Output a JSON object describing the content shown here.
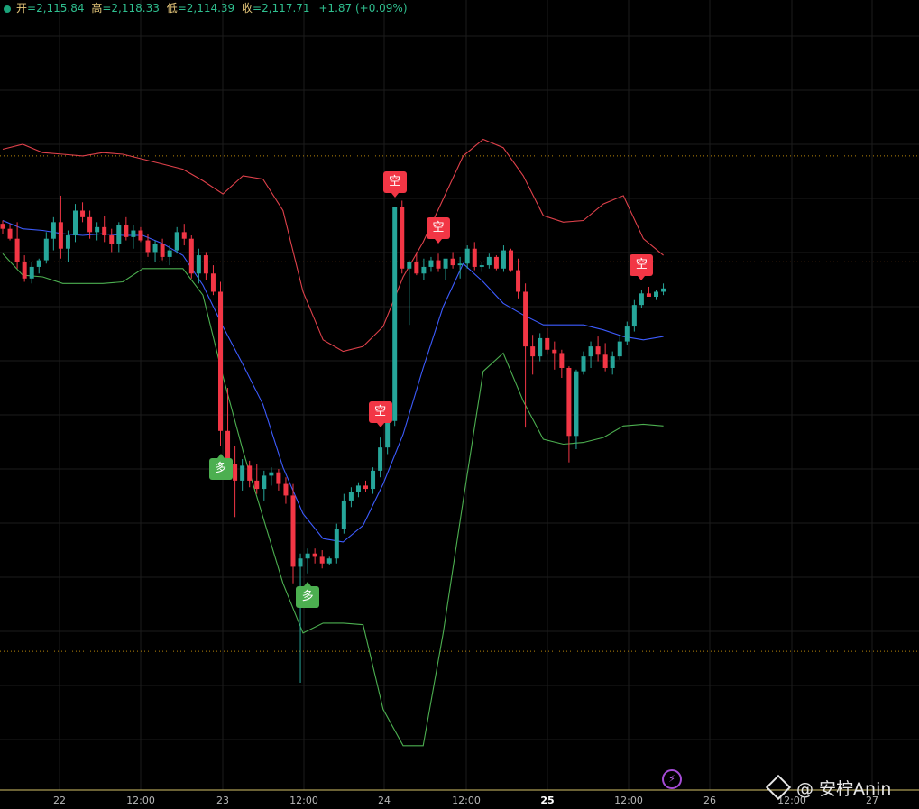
{
  "header": {
    "open_label": "开",
    "open_value": "=2,115.84",
    "high_label": "高",
    "high_value": "=2,118.33",
    "low_label": "低",
    "low_value": "=2,114.39",
    "close_label": "收",
    "close_value": "=2,117.71",
    "change": "+1.87 (+0.09%)"
  },
  "x_axis": {
    "ticks": [
      {
        "label": "22",
        "bold": false
      },
      {
        "label": "12:00",
        "bold": false
      },
      {
        "label": "23",
        "bold": false
      },
      {
        "label": "12:00",
        "bold": false
      },
      {
        "label": "24",
        "bold": false
      },
      {
        "label": "12:00",
        "bold": false
      },
      {
        "label": "25",
        "bold": true
      },
      {
        "label": "12:00",
        "bold": false
      },
      {
        "label": "26",
        "bold": false
      },
      {
        "label": "12:00",
        "bold": false
      },
      {
        "label": "27",
        "bold": false
      }
    ]
  },
  "signals": {
    "short_label": "空",
    "long_label": "多"
  },
  "watermark": {
    "text": "@ 安柠Anin",
    "icon": "binance-square-icon"
  },
  "bolt_icon": "lightning-icon",
  "colors": {
    "up": "#26a69a",
    "down": "#f23645",
    "upper_band": "#e0414b",
    "middle_band": "#3d5cff",
    "lower_band": "#4caf50",
    "dotted_line": "#b8860b",
    "price_line": "#d2691e"
  },
  "chart_data": {
    "type": "candlestick",
    "indicator": "bollinger-bands",
    "price_range": [
      1860,
      2180
    ],
    "candles": [
      [
        2137,
        2139,
        2131,
        2134
      ],
      [
        2134,
        2137,
        2127,
        2128
      ],
      [
        2128,
        2138,
        2110,
        2114
      ],
      [
        2114,
        2118,
        2102,
        2104
      ],
      [
        2104,
        2114,
        2101,
        2111
      ],
      [
        2111,
        2116,
        2107,
        2115
      ],
      [
        2115,
        2132,
        2113,
        2128
      ],
      [
        2128,
        2141,
        2121,
        2138
      ],
      [
        2138,
        2154,
        2116,
        2122
      ],
      [
        2122,
        2133,
        2114,
        2130
      ],
      [
        2130,
        2149,
        2126,
        2145
      ],
      [
        2145,
        2150,
        2138,
        2141
      ],
      [
        2141,
        2145,
        2128,
        2132
      ],
      [
        2132,
        2138,
        2127,
        2135
      ],
      [
        2135,
        2142,
        2126,
        2130
      ],
      [
        2130,
        2134,
        2120,
        2125
      ],
      [
        2125,
        2138,
        2120,
        2136
      ],
      [
        2136,
        2141,
        2127,
        2129
      ],
      [
        2129,
        2136,
        2122,
        2133
      ],
      [
        2133,
        2135,
        2126,
        2127
      ],
      [
        2127,
        2131,
        2117,
        2120
      ],
      [
        2120,
        2127,
        2114,
        2125
      ],
      [
        2125,
        2128,
        2115,
        2117
      ],
      [
        2117,
        2124,
        2112,
        2121
      ],
      [
        2121,
        2135,
        2119,
        2132
      ],
      [
        2132,
        2137,
        2124,
        2128
      ],
      [
        2128,
        2130,
        2104,
        2107
      ],
      [
        2107,
        2122,
        2101,
        2118
      ],
      [
        2118,
        2120,
        2103,
        2107
      ],
      [
        2107,
        2112,
        2094,
        2096
      ],
      [
        2096,
        2102,
        2003,
        2012
      ],
      [
        2012,
        2038,
        1988,
        1992
      ],
      [
        1992,
        2003,
        1960,
        1982
      ],
      [
        1982,
        1995,
        1976,
        1991
      ],
      [
        1991,
        1994,
        1978,
        1982
      ],
      [
        1982,
        1992,
        1974,
        1977
      ],
      [
        1977,
        1988,
        1970,
        1985
      ],
      [
        1985,
        1990,
        1979,
        1987
      ],
      [
        1987,
        1989,
        1976,
        1980
      ],
      [
        1980,
        1984,
        1968,
        1973
      ],
      [
        1973,
        1980,
        1920,
        1930
      ],
      [
        1930,
        1938,
        1860,
        1935
      ],
      [
        1935,
        1941,
        1926,
        1938
      ],
      [
        1938,
        1941,
        1932,
        1936
      ],
      [
        1936,
        1940,
        1929,
        1932
      ],
      [
        1932,
        1936,
        1931,
        1935
      ],
      [
        1935,
        1956,
        1932,
        1953
      ],
      [
        1953,
        1974,
        1950,
        1970
      ],
      [
        1970,
        1978,
        1966,
        1975
      ],
      [
        1975,
        1981,
        1972,
        1979
      ],
      [
        1979,
        1982,
        1975,
        1977
      ],
      [
        1977,
        1990,
        1974,
        1988
      ],
      [
        1988,
        2008,
        1984,
        2002
      ],
      [
        2002,
        2025,
        1998,
        2018
      ],
      [
        2018,
        2147,
        2015,
        2147
      ],
      [
        2147,
        2151,
        2107,
        2110
      ],
      [
        2110,
        2115,
        2076,
        2114
      ],
      [
        2114,
        2120,
        2106,
        2107
      ],
      [
        2107,
        2116,
        2103,
        2111
      ],
      [
        2111,
        2117,
        2108,
        2115
      ],
      [
        2115,
        2119,
        2108,
        2110
      ],
      [
        2110,
        2113,
        2103,
        2116
      ],
      [
        2116,
        2120,
        2110,
        2112
      ],
      [
        2112,
        2117,
        2104,
        2113
      ],
      [
        2113,
        2124,
        2110,
        2122
      ],
      [
        2122,
        2126,
        2109,
        2111
      ],
      [
        2111,
        2114,
        2108,
        2112
      ],
      [
        2112,
        2119,
        2110,
        2117
      ],
      [
        2117,
        2118,
        2109,
        2110
      ],
      [
        2110,
        2124,
        2108,
        2121
      ],
      [
        2121,
        2122,
        2108,
        2109
      ],
      [
        2109,
        2116,
        2092,
        2096
      ],
      [
        2096,
        2101,
        2014,
        2063
      ],
      [
        2063,
        2070,
        2046,
        2057
      ],
      [
        2057,
        2071,
        2054,
        2068
      ],
      [
        2068,
        2074,
        2058,
        2061
      ],
      [
        2061,
        2066,
        2049,
        2059
      ],
      [
        2059,
        2061,
        2044,
        2050
      ],
      [
        2050,
        2051,
        1993,
        2009
      ],
      [
        2009,
        2049,
        2001,
        2048
      ],
      [
        2048,
        2060,
        2046,
        2057
      ],
      [
        2057,
        2066,
        2050,
        2063
      ],
      [
        2063,
        2069,
        2054,
        2058
      ],
      [
        2058,
        2065,
        2048,
        2050
      ],
      [
        2050,
        2060,
        2046,
        2057
      ],
      [
        2057,
        2070,
        2055,
        2066
      ],
      [
        2066,
        2078,
        2064,
        2075
      ],
      [
        2075,
        2091,
        2072,
        2088
      ],
      [
        2088,
        2097,
        2086,
        2095
      ],
      [
        2095,
        2099,
        2093,
        2093
      ],
      [
        2093,
        2097,
        2091,
        2096
      ],
      [
        2096,
        2101,
        2094,
        2098
      ]
    ],
    "bollinger": {
      "upper": [
        2182,
        2185,
        2180,
        2179,
        2178,
        2180,
        2179,
        2176,
        2173,
        2170,
        2163,
        2155,
        2166,
        2164,
        2145,
        2096,
        2067,
        2060,
        2063,
        2075,
        2105,
        2126,
        2152,
        2178,
        2188,
        2183,
        2166,
        2142,
        2138,
        2139,
        2149,
        2154,
        2128,
        2118
      ],
      "middle": [
        2139,
        2134,
        2133,
        2131,
        2130,
        2131,
        2130,
        2130,
        2125,
        2118,
        2100,
        2075,
        2052,
        2028,
        1990,
        1962,
        1947,
        1945,
        1955,
        1980,
        2010,
        2050,
        2087,
        2113,
        2102,
        2089,
        2082,
        2076,
        2076,
        2076,
        2073,
        2069,
        2067,
        2069
      ],
      "lower": [
        2119,
        2106,
        2105,
        2101,
        2101,
        2101,
        2102,
        2110,
        2110,
        2110,
        2094,
        2045,
        2000,
        1960,
        1920,
        1890,
        1896,
        1896,
        1895,
        1844,
        1822,
        1822,
        1890,
        1970,
        2048,
        2059,
        2030,
        2007,
        2004,
        2005,
        2008,
        2015,
        2016,
        2015
      ]
    },
    "reference_lines": [
      2178,
      2114,
      1879
    ],
    "signals": [
      {
        "type": "short",
        "candle": 54
      },
      {
        "type": "long",
        "candle": 30
      },
      {
        "type": "short",
        "candle": 52
      },
      {
        "type": "long",
        "candle": 42
      },
      {
        "type": "short",
        "candle": 60
      },
      {
        "type": "short",
        "candle": 88
      }
    ],
    "x_labels": [
      "22",
      "12:00",
      "23",
      "12:00",
      "24",
      "12:00",
      "25",
      "12:00",
      "26",
      "12:00",
      "27"
    ],
    "grid": true
  }
}
